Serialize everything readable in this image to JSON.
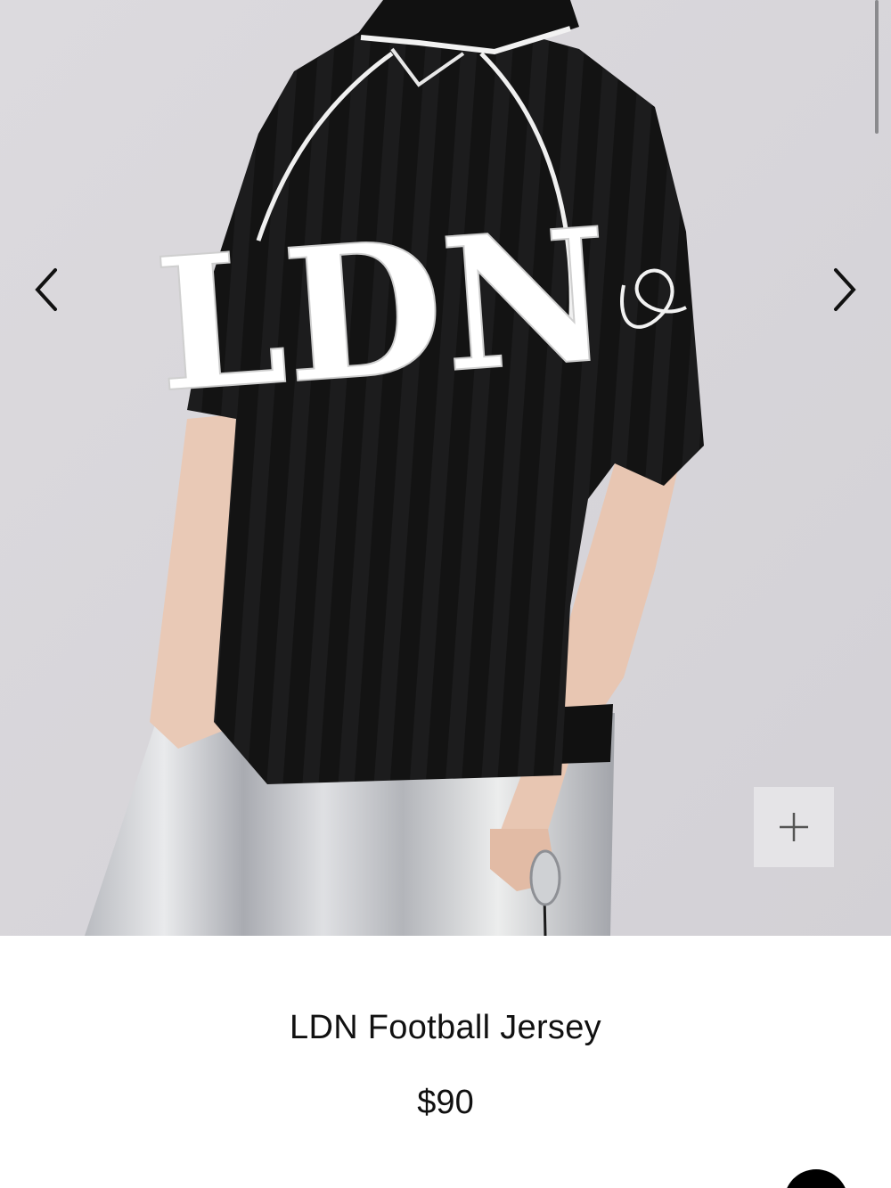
{
  "product": {
    "title": "LDN Football Jersey",
    "price": "$90"
  },
  "gallery": {
    "jersey_print": "LDN",
    "prev_icon": "chevron-left-icon",
    "next_icon": "chevron-right-icon",
    "zoom_icon": "plus-icon"
  },
  "colors": {
    "background_photo": "#d9d7dc",
    "jersey": "#111111",
    "print": "#ffffff",
    "skirt": "#c8c9cc"
  }
}
